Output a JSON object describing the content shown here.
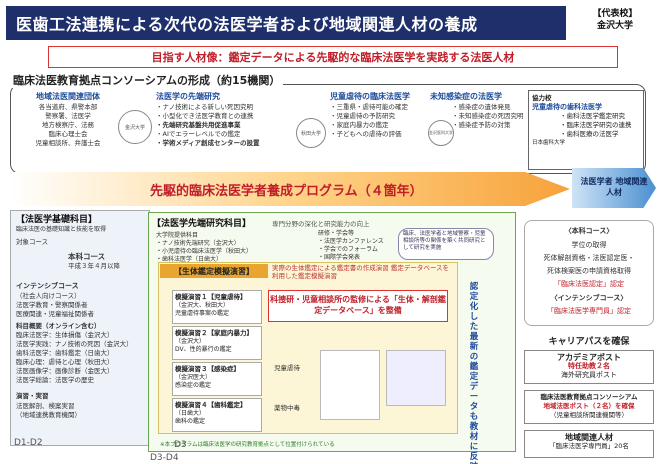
{
  "header": {
    "title": "医歯工法連携による次代の法医学者および地域関連人材の養成",
    "institution_label": "【代表校】",
    "institution_name": "金沢大学"
  },
  "goal": "目指す人材像：鑑定データによる先駆的な臨床法医学を実践する法医人材",
  "consortium": {
    "title": "臨床法医教育拠点コンソーシアムの形成（約15機関）",
    "groups": [
      {
        "head": "地域法医関連団体",
        "lines": [
          "各当道府、県警本部",
          "警察署、法医学",
          "地方検察庁、法務",
          "臨床心理士会",
          "児童相談所、弁護士会"
        ]
      },
      {
        "head": "法医学の先端研究",
        "lines": [
          "・ナノ技術による新しい死因究明",
          "・小型化でき法医学教育との連携",
          "・先端研究基盤共用促進事業",
          "・AIでエラーレベルでの鑑定",
          "・学術メディア創成センターの設置"
        ]
      },
      {
        "head": "児童虐待の臨床法医学",
        "lines": [
          "・三重県・虐待可能の確定",
          "・児童虐待の予防研究",
          "・家庭内暴力の鑑定",
          "・子どもへの虐待の評価"
        ]
      },
      {
        "head": "未知感染症の法医学",
        "lines": [
          "・感染症の遺体発見",
          "・未知感染症の死因究明",
          "・感染症予防の対策"
        ]
      }
    ],
    "logos": [
      "金沢大学",
      "秋田大学",
      "金沢医科大学"
    ],
    "kyoryoku": {
      "label": "協力校",
      "head": "児童虐待の歯科法医学",
      "lines": [
        "・歯科法医学鑑定研究",
        "・臨床法医学研究の連携",
        "・歯科医療の法医学"
      ],
      "school": "日本歯科大学"
    }
  },
  "program": {
    "title": "先駆的臨床法医学者養成プログラム（４箇年）",
    "outcome": "法医学者 地域関連人材"
  },
  "basic": {
    "head": "【法医学基礎科目】",
    "sub": "臨床法医の基礎知識と技能を取得",
    "target": "対象コース",
    "honka": "本科コース",
    "honka_sub": "平成３年４月以降",
    "intensive": "インテンシブコース",
    "intensive_lines": [
      "（社会人向けコース）",
      "法医学教育・警察関係者",
      "医療関連・児童福祉関係者"
    ],
    "online": "科目概要（オンライン含む）",
    "online_lines": [
      "臨床法医学：生体損傷（金沢大）",
      "法医学実践：ナノ技術の死因（金沢大）",
      "歯科法医学：歯科鑑定（日歯大）",
      "臨床心理：虐待と心理（秋田大）",
      "法医画像学：画像診断（金医大）",
      "法医学総論：法医学の歴史"
    ],
    "practice": "演習・実習",
    "practice_lines": [
      "法医解剖、検案実習",
      "（地域連携教育機関）"
    ],
    "level": "D1-D2"
  },
  "advanced": {
    "head": "【法医学先端研究科目】",
    "sub": "専門分野の深化と研究能力の向上",
    "univ_lines": [
      "大学院提供科目",
      "・ナノ技術先端研究（金沢大）",
      "・小児虐待の臨床法医学（秋田大）",
      "・歯科法医学（日歯大）"
    ],
    "research": [
      "研修・学会等",
      "・法医学カンファレンス",
      "・学会でのフォーラム",
      "・国際学会発表"
    ],
    "bubble": "臨床、法医学者と地域警察・児童相談所等の関係を築く共同研究として研究を実施",
    "level": "D3",
    "level2": "D3-D4"
  },
  "lab": {
    "head": "【生体鑑定模擬演習】",
    "sub": "実際の生体鑑定による鑑定書の作成演習 鑑定データベースを利用した鑑定模擬演習",
    "exercises": [
      {
        "title": "模擬演習１【児童虐待】",
        "lines": [
          "（金沢大、秋田大）",
          "児童虐待事案の鑑定"
        ]
      },
      {
        "title": "模擬演習２【家庭内暴力】",
        "lines": [
          "（金沢大）",
          "DV、性的暴行の鑑定"
        ]
      },
      {
        "title": "模擬演習３【感染症】",
        "lines": [
          "（金沢医大）",
          "感染症の鑑定"
        ]
      },
      {
        "title": "模擬演習４【歯科鑑定】",
        "lines": [
          "（日歯大）",
          "歯科の鑑定"
        ]
      }
    ],
    "red_box": "科捜研・児童相談所の監修による「生体・解剖鑑定データベース」を整備",
    "categories": [
      "児童虐待",
      "薬物中毒"
    ],
    "vertical": "認定化した最新の鑑定データも教材に反映",
    "note": "※本プログラムは臨床法医学の研究教育拠点として位置付けられている"
  },
  "right": {
    "honka": "〈本科コース〉",
    "honka_lines": [
      "学位の取得",
      "死体解剖資格・法医認定医・",
      "死体検案医の申請資格取得"
    ],
    "honka_note": "「臨床法医認定」認定",
    "intensive": "〈インテンシブコース〉",
    "intensive_note": "「臨床法医学専門員」認定",
    "career": "キャリアパスを確保",
    "academic": "アカデミアポスト",
    "academic_red": "特任助教２名",
    "academic_sub": "海外研究員ポスト",
    "cons_post": "臨床法医教育拠点コンソーシアム",
    "cons_post_red": "地域法医ポスト（２名）を確保",
    "cons_post_sub": "（児童相談所関連機関等）",
    "regional": "地域関連人材",
    "regional_sub": "「臨床法医学専門員」20名"
  },
  "colors": {
    "navy": "#1e2f6b",
    "red": "#c0202a",
    "orange": "#f7a23b",
    "green": "#6aa84f"
  }
}
